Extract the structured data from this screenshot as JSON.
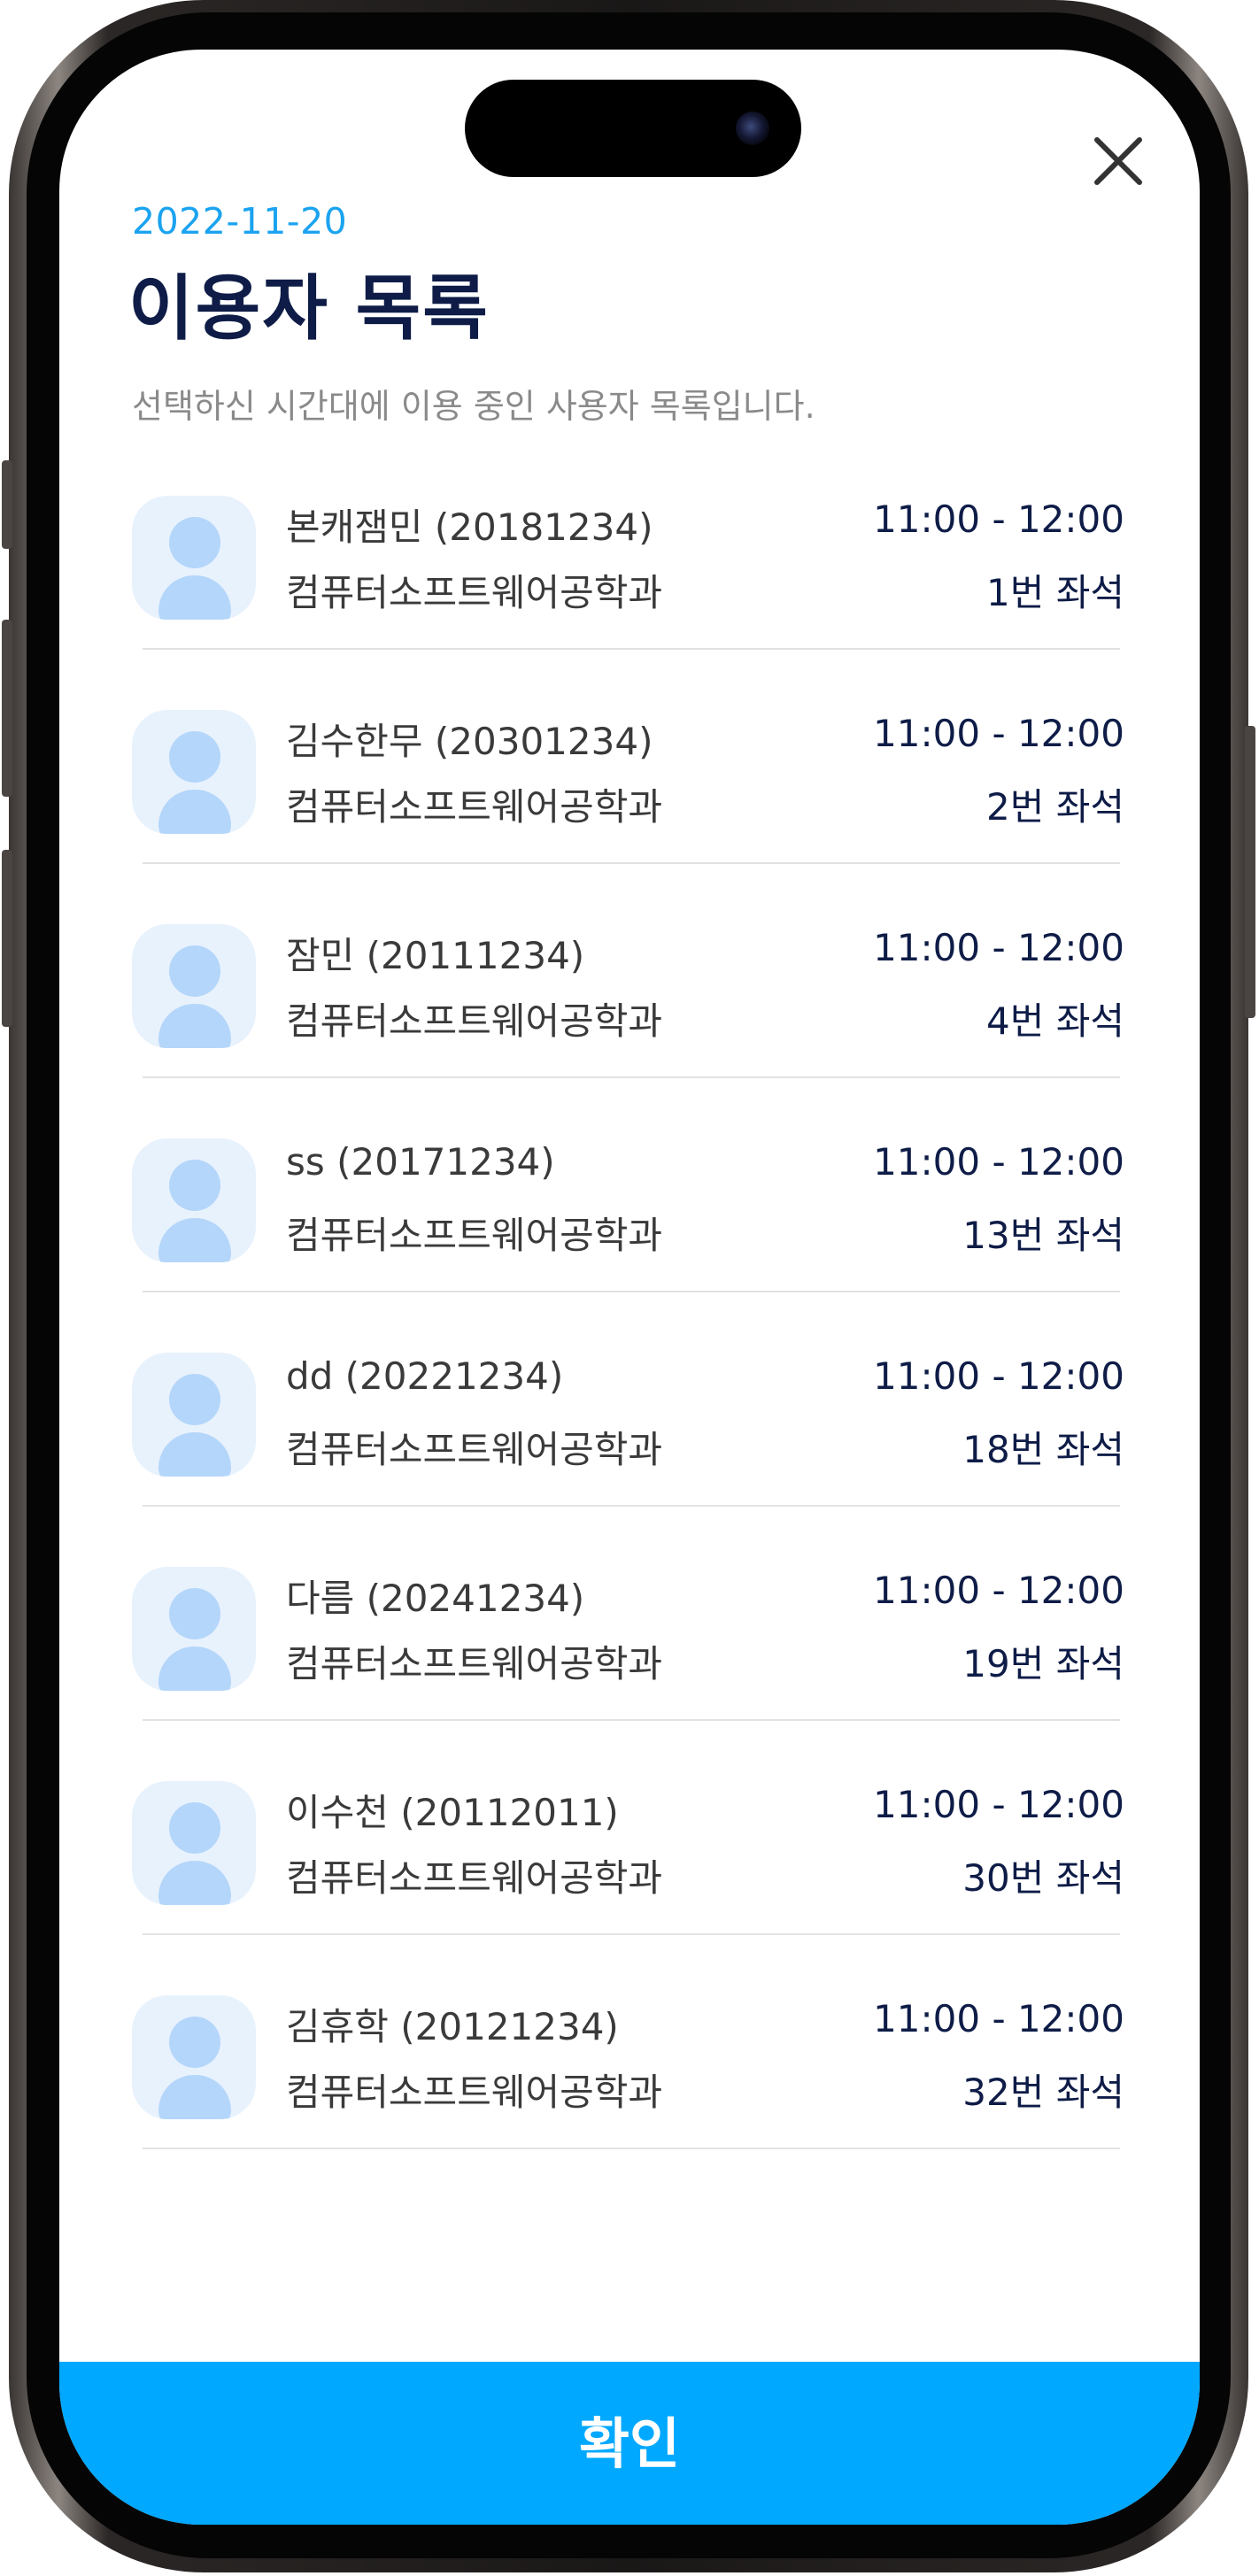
{
  "header": {
    "date": "2022-11-20",
    "title": "이용자 목록",
    "subtitle": "선택하신 시간대에 이용 중인 사용자 목록입니다."
  },
  "users": [
    {
      "name": "본캐잼민 (20181234)",
      "department": "컴퓨터소프트웨어공학과",
      "time": "11:00 - 12:00",
      "seat": "1번 좌석"
    },
    {
      "name": "김수한무 (20301234)",
      "department": "컴퓨터소프트웨어공학과",
      "time": "11:00 - 12:00",
      "seat": "2번 좌석"
    },
    {
      "name": "잠민 (20111234)",
      "department": "컴퓨터소프트웨어공학과",
      "time": "11:00 - 12:00",
      "seat": "4번 좌석"
    },
    {
      "name": "ss (20171234)",
      "department": "컴퓨터소프트웨어공학과",
      "time": "11:00 - 12:00",
      "seat": "13번 좌석"
    },
    {
      "name": "dd (20221234)",
      "department": "컴퓨터소프트웨어공학과",
      "time": "11:00 - 12:00",
      "seat": "18번 좌석"
    },
    {
      "name": "다름 (20241234)",
      "department": "컴퓨터소프트웨어공학과",
      "time": "11:00 - 12:00",
      "seat": "19번 좌석"
    },
    {
      "name": "이수천 (20112011)",
      "department": "컴퓨터소프트웨어공학과",
      "time": "11:00 - 12:00",
      "seat": "30번 좌석"
    },
    {
      "name": "김휴학 (20121234)",
      "department": "컴퓨터소프트웨어공학과",
      "time": "11:00 - 12:00",
      "seat": "32번 좌석"
    }
  ],
  "footer": {
    "confirm_label": "확인"
  },
  "icons": {
    "close": "close-icon",
    "avatar": "user-avatar-icon"
  },
  "colors": {
    "accent": "#00a8ff",
    "date": "#1aa3f0",
    "title": "#0e1c47",
    "avatar_bg": "#e8f2fd",
    "avatar_fg": "#b4d6fa"
  }
}
